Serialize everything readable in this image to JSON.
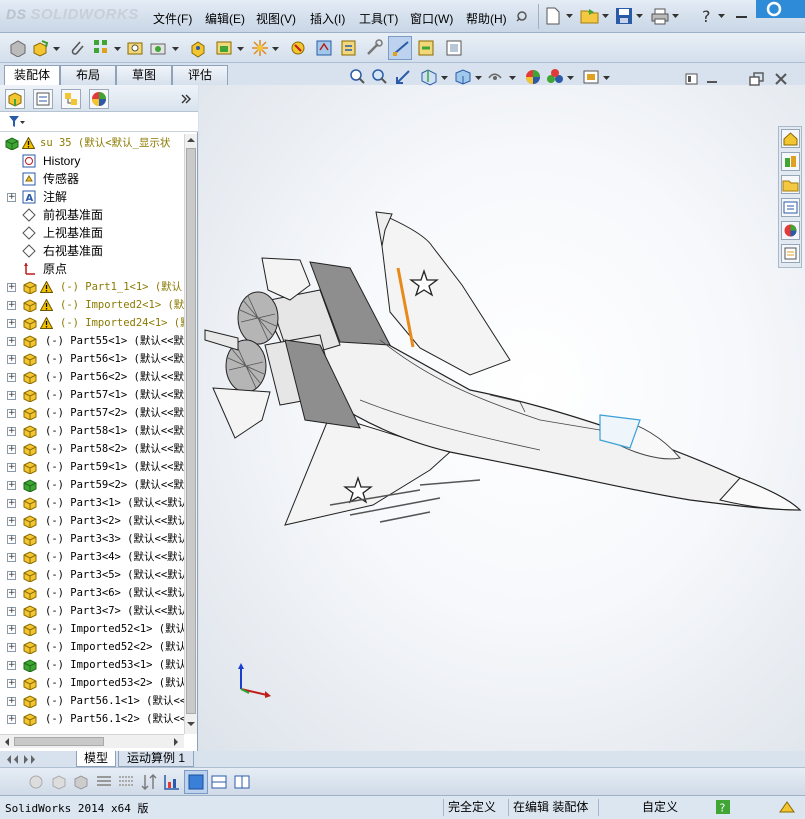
{
  "app": {
    "brand": "SOLIDWORKS",
    "brand_prefix": "DS"
  },
  "menu": [
    "文件(F)",
    "编辑(E)",
    "视图(V)",
    "插入(I)",
    "工具(T)",
    "窗口(W)",
    "帮助(H)"
  ],
  "tabs": [
    "装配体",
    "布局",
    "草图",
    "评估"
  ],
  "tree": {
    "root": "su 35  (默认<默认_显示状",
    "items": [
      {
        "label": "History",
        "icon": "history-icon",
        "expand": false
      },
      {
        "label": "传感器",
        "icon": "sensor-icon",
        "expand": false
      },
      {
        "label": "注解",
        "icon": "annotation-icon",
        "expand": true
      },
      {
        "label": "前视基准面",
        "icon": "plane-icon",
        "expand": false
      },
      {
        "label": "上视基准面",
        "icon": "plane-icon",
        "expand": false
      },
      {
        "label": "右视基准面",
        "icon": "plane-icon",
        "expand": false
      },
      {
        "label": "原点",
        "icon": "origin-icon",
        "expand": false
      }
    ],
    "parts": [
      {
        "label": "(-) Part1_1<1> (默认",
        "warn": true,
        "color": "yellow"
      },
      {
        "label": "(-) Imported2<1> (默",
        "warn": true,
        "color": "yellow"
      },
      {
        "label": "(-) Imported24<1> (默",
        "warn": true,
        "color": "yellow"
      },
      {
        "label": "(-) Part55<1> (默认<<默",
        "warn": false,
        "color": "yellow"
      },
      {
        "label": "(-) Part56<1> (默认<<默",
        "warn": false,
        "color": "yellow"
      },
      {
        "label": "(-) Part56<2> (默认<<默",
        "warn": false,
        "color": "yellow"
      },
      {
        "label": "(-) Part57<1> (默认<<默",
        "warn": false,
        "color": "yellow"
      },
      {
        "label": "(-) Part57<2> (默认<<默",
        "warn": false,
        "color": "yellow"
      },
      {
        "label": "(-) Part58<1> (默认<<默",
        "warn": false,
        "color": "yellow"
      },
      {
        "label": "(-) Part58<2> (默认<<默",
        "warn": false,
        "color": "yellow"
      },
      {
        "label": "(-) Part59<1> (默认<<默",
        "warn": false,
        "color": "yellow"
      },
      {
        "label": "(-) Part59<2> (默认<<默",
        "warn": false,
        "color": "green"
      },
      {
        "label": "(-) Part3<1> (默认<<默认",
        "warn": false,
        "color": "yellow"
      },
      {
        "label": "(-) Part3<2> (默认<<默认",
        "warn": false,
        "color": "yellow"
      },
      {
        "label": "(-) Part3<3> (默认<<默认",
        "warn": false,
        "color": "yellow"
      },
      {
        "label": "(-) Part3<4> (默认<<默认",
        "warn": false,
        "color": "yellow"
      },
      {
        "label": "(-) Part3<5> (默认<<默认",
        "warn": false,
        "color": "yellow"
      },
      {
        "label": "(-) Part3<6> (默认<<默认",
        "warn": false,
        "color": "yellow"
      },
      {
        "label": "(-) Part3<7> (默认<<默认",
        "warn": false,
        "color": "yellow"
      },
      {
        "label": "(-) Imported52<1> (默认",
        "warn": false,
        "color": "yellow"
      },
      {
        "label": "(-) Imported52<2> (默认",
        "warn": false,
        "color": "yellow"
      },
      {
        "label": "(-) Imported53<1> (默认",
        "warn": false,
        "color": "green"
      },
      {
        "label": "(-) Imported53<2> (默认",
        "warn": false,
        "color": "yellow"
      },
      {
        "label": "(-) Part56.1<1> (默认<<",
        "warn": false,
        "color": "yellow"
      },
      {
        "label": "(-) Part56.1<2> (默认<<",
        "warn": false,
        "color": "yellow"
      }
    ]
  },
  "bottom_tabs": [
    "模型",
    "运动算例 1"
  ],
  "status": {
    "app": "SolidWorks 2014 x64 版",
    "defined": "完全定义",
    "editing": "在编辑 装配体",
    "custom": "自定义"
  },
  "colors": {
    "accent": "#3a6ea5",
    "warn": "#f2c200",
    "orange_stripe": "#e88a1a"
  }
}
